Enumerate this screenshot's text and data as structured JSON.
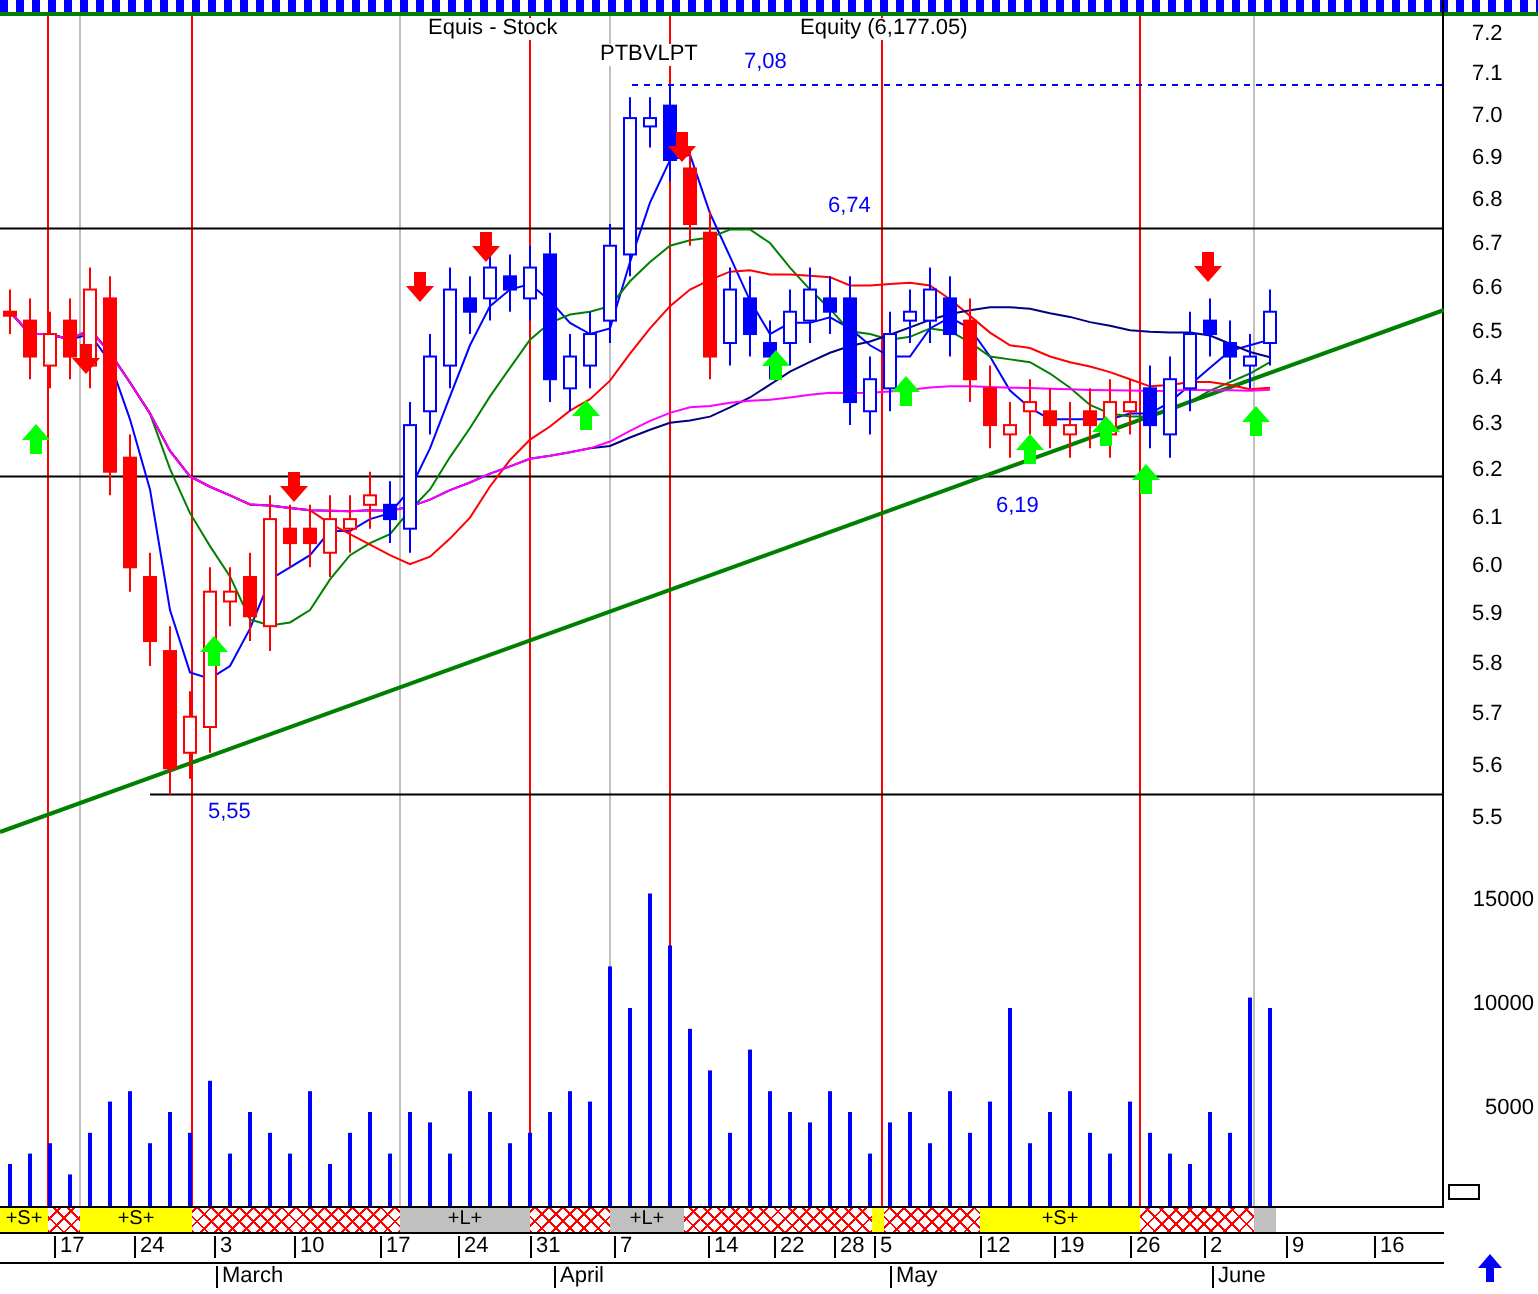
{
  "title": {
    "name": "Equis - Stock",
    "value": "Equity (6,177.05)",
    "ticker": "PTBVLPT"
  },
  "price_levels": [
    {
      "label": "7,08"
    },
    {
      "label": "6,74"
    },
    {
      "label": "6,19"
    },
    {
      "label": "5,55"
    }
  ],
  "price_axis": [
    "7.2",
    "7.1",
    "7.0",
    "6.9",
    "6.8",
    "6.7",
    "6.6",
    "6.5",
    "6.4",
    "6.3",
    "6.2",
    "6.1",
    "6.0",
    "5.9",
    "5.8",
    "5.7",
    "5.6",
    "5.5"
  ],
  "volume_axis": [
    "15000",
    "10000",
    "5000"
  ],
  "signal_bands": [
    {
      "kind": "short",
      "label": "+S+"
    },
    {
      "kind": "neutral"
    },
    {
      "kind": "short",
      "label": "+S+"
    },
    {
      "kind": "neutral"
    },
    {
      "kind": "long",
      "label": "+L+"
    },
    {
      "kind": "neutral"
    },
    {
      "kind": "long",
      "label": "+L+"
    },
    {
      "kind": "neutral"
    },
    {
      "kind": "short"
    },
    {
      "kind": "neutral"
    },
    {
      "kind": "short",
      "label": "+S+"
    },
    {
      "kind": "neutral"
    },
    {
      "kind": "long"
    }
  ],
  "dates": [
    "17",
    "24",
    "3",
    "10",
    "17",
    "24",
    "31",
    "7",
    "14",
    "22",
    "28",
    "5",
    "12",
    "19",
    "26",
    "2",
    "9",
    "16"
  ],
  "months": [
    "March",
    "April",
    "May",
    "June"
  ]
}
